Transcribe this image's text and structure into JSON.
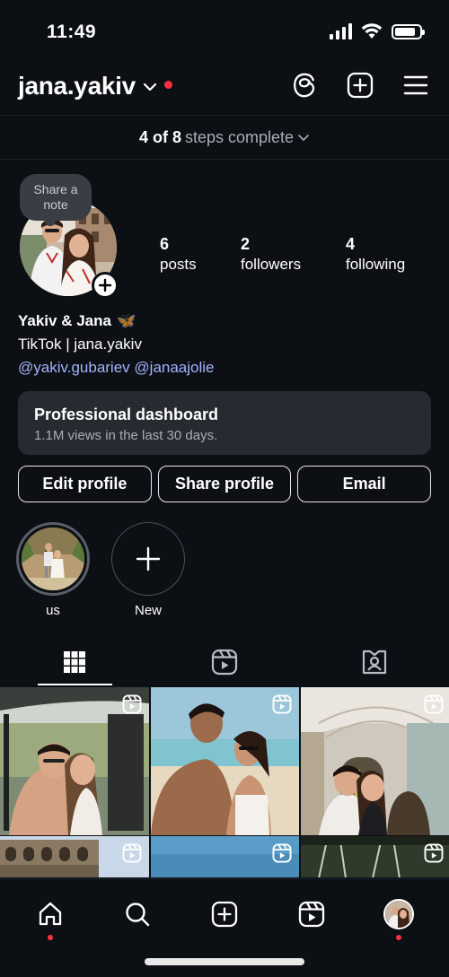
{
  "status_bar": {
    "time": "11:49",
    "battery_level": 0.85
  },
  "header": {
    "username": "jana.yakiv"
  },
  "steps": {
    "done": "4 of 8",
    "rest": "steps complete"
  },
  "profile": {
    "note_bubble": "Share a note",
    "stats": [
      {
        "value": "6",
        "label": "posts"
      },
      {
        "value": "2",
        "label": "followers"
      },
      {
        "value": "4",
        "label": "following"
      }
    ],
    "name": "Yakiv & Jana",
    "name_emoji": "🦋",
    "bio_line": "TikTok | jana.yakiv",
    "mentions": [
      "@yakiv.gubariev",
      "@janaajolie"
    ]
  },
  "dashboard": {
    "title": "Professional dashboard",
    "subtitle": "1.1M views in the last 30 days."
  },
  "actions": {
    "edit": "Edit profile",
    "share": "Share profile",
    "email": "Email"
  },
  "highlights": [
    {
      "label": "us"
    },
    {
      "label": "New"
    }
  ],
  "tabs": [
    {
      "icon": "grid-icon",
      "active": true
    },
    {
      "icon": "reels-icon",
      "active": false
    },
    {
      "icon": "tagged-icon",
      "active": false
    }
  ],
  "nav": [
    "home-icon",
    "search-icon",
    "create-icon",
    "reels-icon",
    "profile-avatar"
  ],
  "colors": {
    "accent_red": "#ff3040",
    "link": "#a2b4ff",
    "background": "#0c0f14",
    "card": "#262a31"
  }
}
